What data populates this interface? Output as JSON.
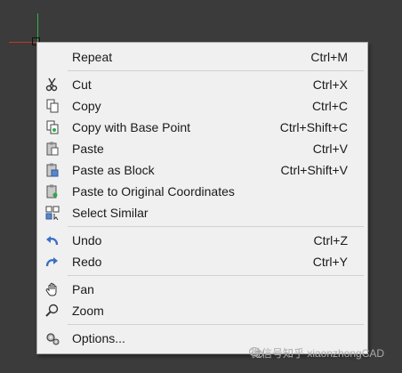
{
  "menu": {
    "items": [
      {
        "label": "Repeat",
        "shortcut": "Ctrl+M",
        "icon": ""
      },
      {
        "label": "Cut",
        "shortcut": "Ctrl+X",
        "icon": "scissors-icon"
      },
      {
        "label": "Copy",
        "shortcut": "Ctrl+C",
        "icon": "copy-icon"
      },
      {
        "label": "Copy with Base Point",
        "shortcut": "Ctrl+Shift+C",
        "icon": "copy-base-point-icon"
      },
      {
        "label": "Paste",
        "shortcut": "Ctrl+V",
        "icon": "paste-icon"
      },
      {
        "label": "Paste as Block",
        "shortcut": "Ctrl+Shift+V",
        "icon": "paste-block-icon"
      },
      {
        "label": "Paste to Original Coordinates",
        "shortcut": "",
        "icon": "paste-original-icon"
      },
      {
        "label": "Select Similar",
        "shortcut": "",
        "icon": "select-similar-icon"
      },
      {
        "label": "Undo",
        "shortcut": "Ctrl+Z",
        "icon": "undo-icon"
      },
      {
        "label": "Redo",
        "shortcut": "Ctrl+Y",
        "icon": "redo-icon"
      },
      {
        "label": "Pan",
        "shortcut": "",
        "icon": "hand-icon"
      },
      {
        "label": "Zoom",
        "shortcut": "",
        "icon": "magnifier-icon"
      },
      {
        "label": "Options...",
        "shortcut": "",
        "icon": "gear-icon"
      }
    ]
  },
  "watermark": {
    "text": "微信号知乎 xiaonzhongCAD"
  },
  "colors": {
    "menu_bg": "#f0f0f0",
    "desktop_bg": "#3b3b3b",
    "icon_blue": "#3a6fc4"
  }
}
